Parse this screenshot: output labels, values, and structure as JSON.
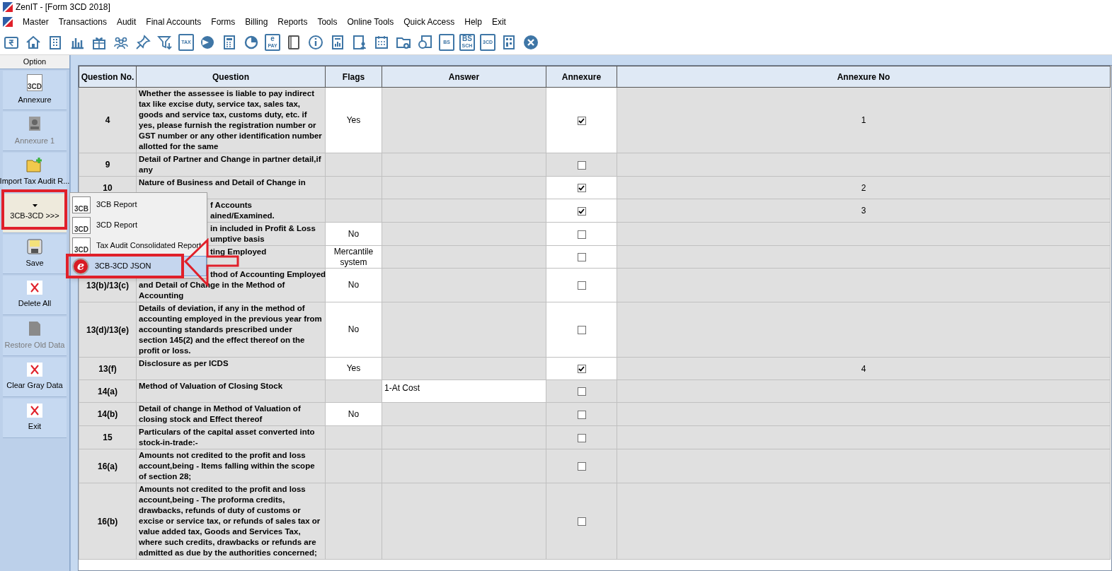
{
  "window": {
    "title": "ZenIT - [Form 3CD 2018]"
  },
  "menu_bar": [
    "Master",
    "Transactions",
    "Audit",
    "Final Accounts",
    "Forms",
    "Billing",
    "Reports",
    "Tools",
    "Online Tools",
    "Quick Access",
    "Help",
    "Exit"
  ],
  "toolbar": [
    {
      "kind": "glyph"
    },
    {
      "kind": "glyph"
    },
    {
      "kind": "glyph"
    },
    {
      "kind": "glyph"
    },
    {
      "kind": "glyph"
    },
    {
      "kind": "glyph"
    },
    {
      "kind": "glyph"
    },
    {
      "kind": "glyph"
    },
    {
      "kind": "text",
      "label": "TAX"
    },
    {
      "kind": "glyph"
    },
    {
      "kind": "glyph"
    },
    {
      "kind": "glyph"
    },
    {
      "kind": "text",
      "top": "e",
      "label": "PAY"
    },
    {
      "kind": "glyph"
    },
    {
      "kind": "glyph"
    },
    {
      "kind": "glyph"
    },
    {
      "kind": "glyph"
    },
    {
      "kind": "glyph"
    },
    {
      "kind": "glyph"
    },
    {
      "kind": "glyph"
    },
    {
      "kind": "text",
      "label": "BS"
    },
    {
      "kind": "text",
      "top": "BS",
      "label": "SCH"
    },
    {
      "kind": "text",
      "label": "3CD"
    },
    {
      "kind": "glyph"
    },
    {
      "kind": "glyph"
    }
  ],
  "sidebar": {
    "title": "Option",
    "items": [
      {
        "kind": "doc",
        "icon_text": "3CD",
        "label": "Annexure",
        "disabled": false,
        "highlighted": false
      },
      {
        "kind": "stamp",
        "label": "Annexure 1",
        "disabled": true,
        "highlighted": false
      },
      {
        "kind": "folder",
        "label": "Import Tax Audit R...",
        "disabled": false,
        "highlighted": false
      },
      {
        "kind": "dropdown",
        "label": "3CB-3CD >>>",
        "disabled": false,
        "highlighted": true
      },
      {
        "kind": "save",
        "label": "Save",
        "disabled": false,
        "highlighted": false
      },
      {
        "kind": "cross",
        "label": "Delete All",
        "disabled": false,
        "highlighted": false
      },
      {
        "kind": "sheet",
        "label": "Restore Old Data",
        "disabled": true,
        "highlighted": false
      },
      {
        "kind": "cross",
        "label": "Clear Gray Data",
        "disabled": false,
        "highlighted": false
      },
      {
        "kind": "cross",
        "label": "Exit",
        "disabled": false,
        "highlighted": false
      }
    ]
  },
  "popup_menu": [
    {
      "kind": "doc",
      "icon_text": "3CB",
      "label": "3CB Report",
      "selected": false
    },
    {
      "kind": "doc",
      "icon_text": "3CD",
      "label": "3CD Report",
      "selected": false
    },
    {
      "kind": "doc",
      "icon_text": "3CD",
      "label": "Tax Audit Consolidated Report",
      "selected": false
    },
    {
      "kind": "json",
      "icon_text": "e",
      "label": "3CB-3CD JSON",
      "selected": true
    }
  ],
  "table": {
    "columns": [
      "Question No.",
      "Question",
      "Flags",
      "Answer",
      "Annexure",
      "Annexure No"
    ],
    "rows": [
      {
        "kind": "full",
        "number": "4",
        "question": "Whether the assessee is liable to pay indirect tax like excise duty, service tax, sales tax, goods and service tax, customs duty, etc. if yes, please furnish the registration number or GST number or any other identification number allotted for the same",
        "flag": "Yes",
        "annexure": true,
        "annexure_editable": true,
        "annexure_no": "1"
      },
      {
        "kind": "full",
        "number": "9",
        "question": "Detail of Partner and Change in partner detail,if any",
        "annexure": false,
        "annexure_editable": false
      },
      {
        "kind": "full",
        "number": "10",
        "question": "Nature of Business and Detail of Change in",
        "annexure": true,
        "annexure_editable": true,
        "annexure_no": "2"
      },
      {
        "kind": "covered",
        "question": "f Accounts\nained/Examined.",
        "annexure": true,
        "annexure_editable": true,
        "annexure_no": "3"
      },
      {
        "kind": "covered",
        "question": "in included in Profit & Loss\numptive basis",
        "flag": "No",
        "annexure": false,
        "annexure_editable": true
      },
      {
        "kind": "covered",
        "question": "ting Employed",
        "flag": "Mercantile system",
        "annexure": false,
        "annexure_editable": true
      },
      {
        "kind": "covered_first",
        "number": "13(b)/13(c)",
        "question": "thod of Accounting Employed\nand Detail of Change in the Method of\nAccounting",
        "flag": "No",
        "annexure": false,
        "annexure_editable": true
      },
      {
        "kind": "full",
        "number": "13(d)/13(e)",
        "question": "Details of deviation, if any in the method of accounting employed in the previous year from accounting standards prescribed under section 145(2) and the effect thereof on the profit or loss.",
        "flag": "No",
        "annexure": false,
        "annexure_editable": true
      },
      {
        "kind": "full",
        "number": "13(f)",
        "question": "Disclosure as per ICDS",
        "flag": "Yes",
        "annexure": true,
        "annexure_editable": true,
        "annexure_no": "4"
      },
      {
        "kind": "full",
        "number": "14(a)",
        "question": "Method of Valuation of Closing Stock",
        "answer": "1-At Cost",
        "annexure": false,
        "annexure_editable": false
      },
      {
        "kind": "full",
        "number": "14(b)",
        "question": "Detail of change in Method of Valuation of closing stock and Effect thereof",
        "flag": "No",
        "annexure": false,
        "annexure_editable": false
      },
      {
        "kind": "full",
        "number": "15",
        "question": "Particulars of the capital asset converted into stock-in-trade:-",
        "annexure": false,
        "annexure_editable": false
      },
      {
        "kind": "full",
        "number": "16(a)",
        "question": "Amounts not credited to the profit and loss account,being - Items falling within the scope of section 28;",
        "annexure": false,
        "annexure_editable": false
      },
      {
        "kind": "full",
        "number": "16(b)",
        "question": "Amounts not credited to the profit and loss account,being - The proforma credits, drawbacks, refunds of duty of customs or excise or service tax, or refunds  of sales tax or value added tax, Goods and Services Tax, where such credits, drawbacks or refunds are admitted as due by the authorities concerned;",
        "annexure": false,
        "annexure_editable": false
      }
    ]
  }
}
